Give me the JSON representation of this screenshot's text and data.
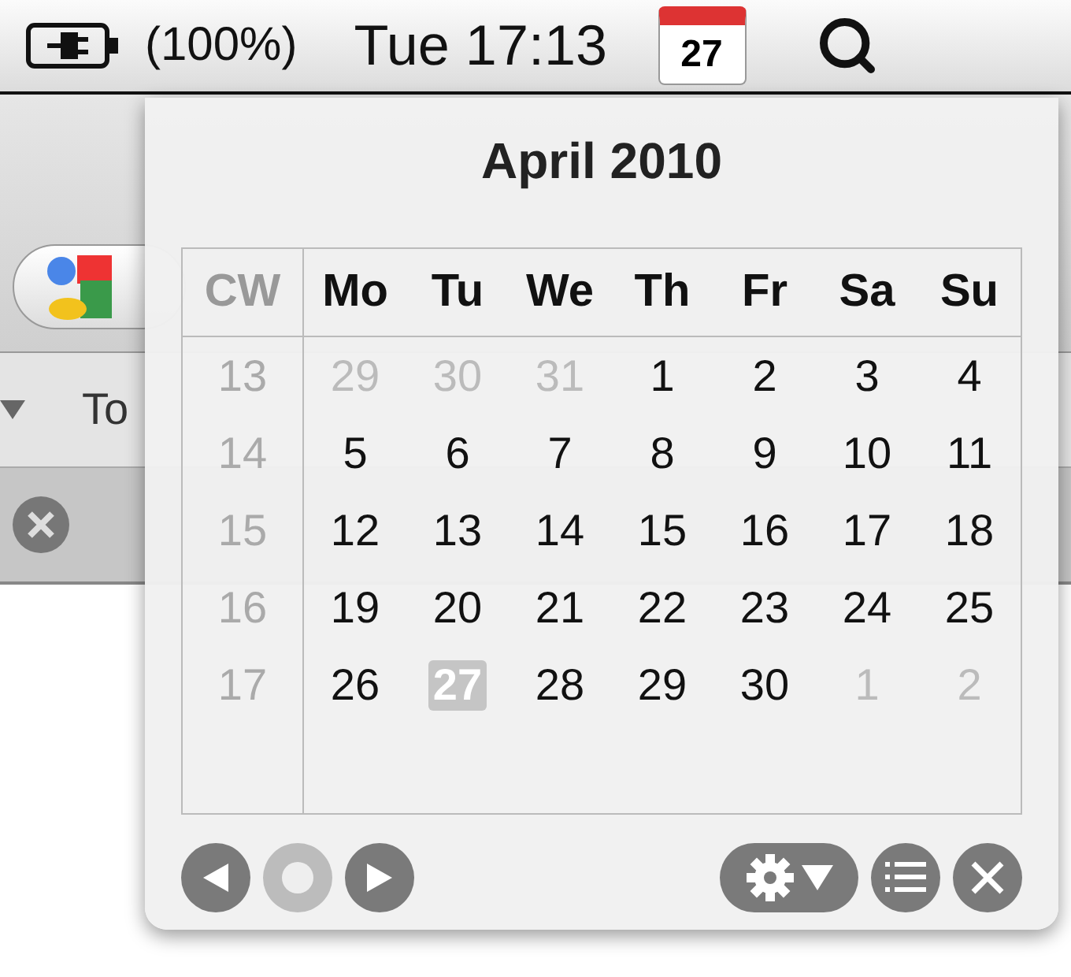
{
  "menu_bar": {
    "battery": "(100%)",
    "clock": "Tue 17:13",
    "calendar_day": "27"
  },
  "browser": {
    "bookmark": "To"
  },
  "calendar": {
    "title": "April 2010",
    "columns": [
      "CW",
      "Mo",
      "Tu",
      "We",
      "Th",
      "Fr",
      "Sa",
      "Su"
    ],
    "weeks": [
      {
        "cw": "13",
        "days": [
          {
            "label": "29",
            "in_month": false,
            "selected": false
          },
          {
            "label": "30",
            "in_month": false,
            "selected": false
          },
          {
            "label": "31",
            "in_month": false,
            "selected": false
          },
          {
            "label": "1",
            "in_month": true,
            "selected": false
          },
          {
            "label": "2",
            "in_month": true,
            "selected": false
          },
          {
            "label": "3",
            "in_month": true,
            "selected": false
          },
          {
            "label": "4",
            "in_month": true,
            "selected": false
          }
        ]
      },
      {
        "cw": "14",
        "days": [
          {
            "label": "5",
            "in_month": true,
            "selected": false
          },
          {
            "label": "6",
            "in_month": true,
            "selected": false
          },
          {
            "label": "7",
            "in_month": true,
            "selected": false
          },
          {
            "label": "8",
            "in_month": true,
            "selected": false
          },
          {
            "label": "9",
            "in_month": true,
            "selected": false
          },
          {
            "label": "10",
            "in_month": true,
            "selected": false
          },
          {
            "label": "11",
            "in_month": true,
            "selected": false
          }
        ]
      },
      {
        "cw": "15",
        "days": [
          {
            "label": "12",
            "in_month": true,
            "selected": false
          },
          {
            "label": "13",
            "in_month": true,
            "selected": false
          },
          {
            "label": "14",
            "in_month": true,
            "selected": false
          },
          {
            "label": "15",
            "in_month": true,
            "selected": false
          },
          {
            "label": "16",
            "in_month": true,
            "selected": false
          },
          {
            "label": "17",
            "in_month": true,
            "selected": false
          },
          {
            "label": "18",
            "in_month": true,
            "selected": false
          }
        ]
      },
      {
        "cw": "16",
        "days": [
          {
            "label": "19",
            "in_month": true,
            "selected": false
          },
          {
            "label": "20",
            "in_month": true,
            "selected": false
          },
          {
            "label": "21",
            "in_month": true,
            "selected": false
          },
          {
            "label": "22",
            "in_month": true,
            "selected": false
          },
          {
            "label": "23",
            "in_month": true,
            "selected": false
          },
          {
            "label": "24",
            "in_month": true,
            "selected": false
          },
          {
            "label": "25",
            "in_month": true,
            "selected": false
          }
        ]
      },
      {
        "cw": "17",
        "days": [
          {
            "label": "26",
            "in_month": true,
            "selected": false
          },
          {
            "label": "27",
            "in_month": true,
            "selected": true
          },
          {
            "label": "28",
            "in_month": true,
            "selected": false
          },
          {
            "label": "29",
            "in_month": true,
            "selected": false
          },
          {
            "label": "30",
            "in_month": true,
            "selected": false
          },
          {
            "label": "1",
            "in_month": false,
            "selected": false
          },
          {
            "label": "2",
            "in_month": false,
            "selected": false
          }
        ]
      }
    ],
    "nav_buttons": [
      {
        "kind": "previous",
        "disabled": false
      },
      {
        "kind": "today",
        "disabled": true
      },
      {
        "kind": "next",
        "disabled": false
      }
    ],
    "tool_buttons": [
      {
        "kind": "settings",
        "disabled": false
      },
      {
        "kind": "list",
        "disabled": false
      },
      {
        "kind": "close",
        "disabled": false
      }
    ]
  }
}
